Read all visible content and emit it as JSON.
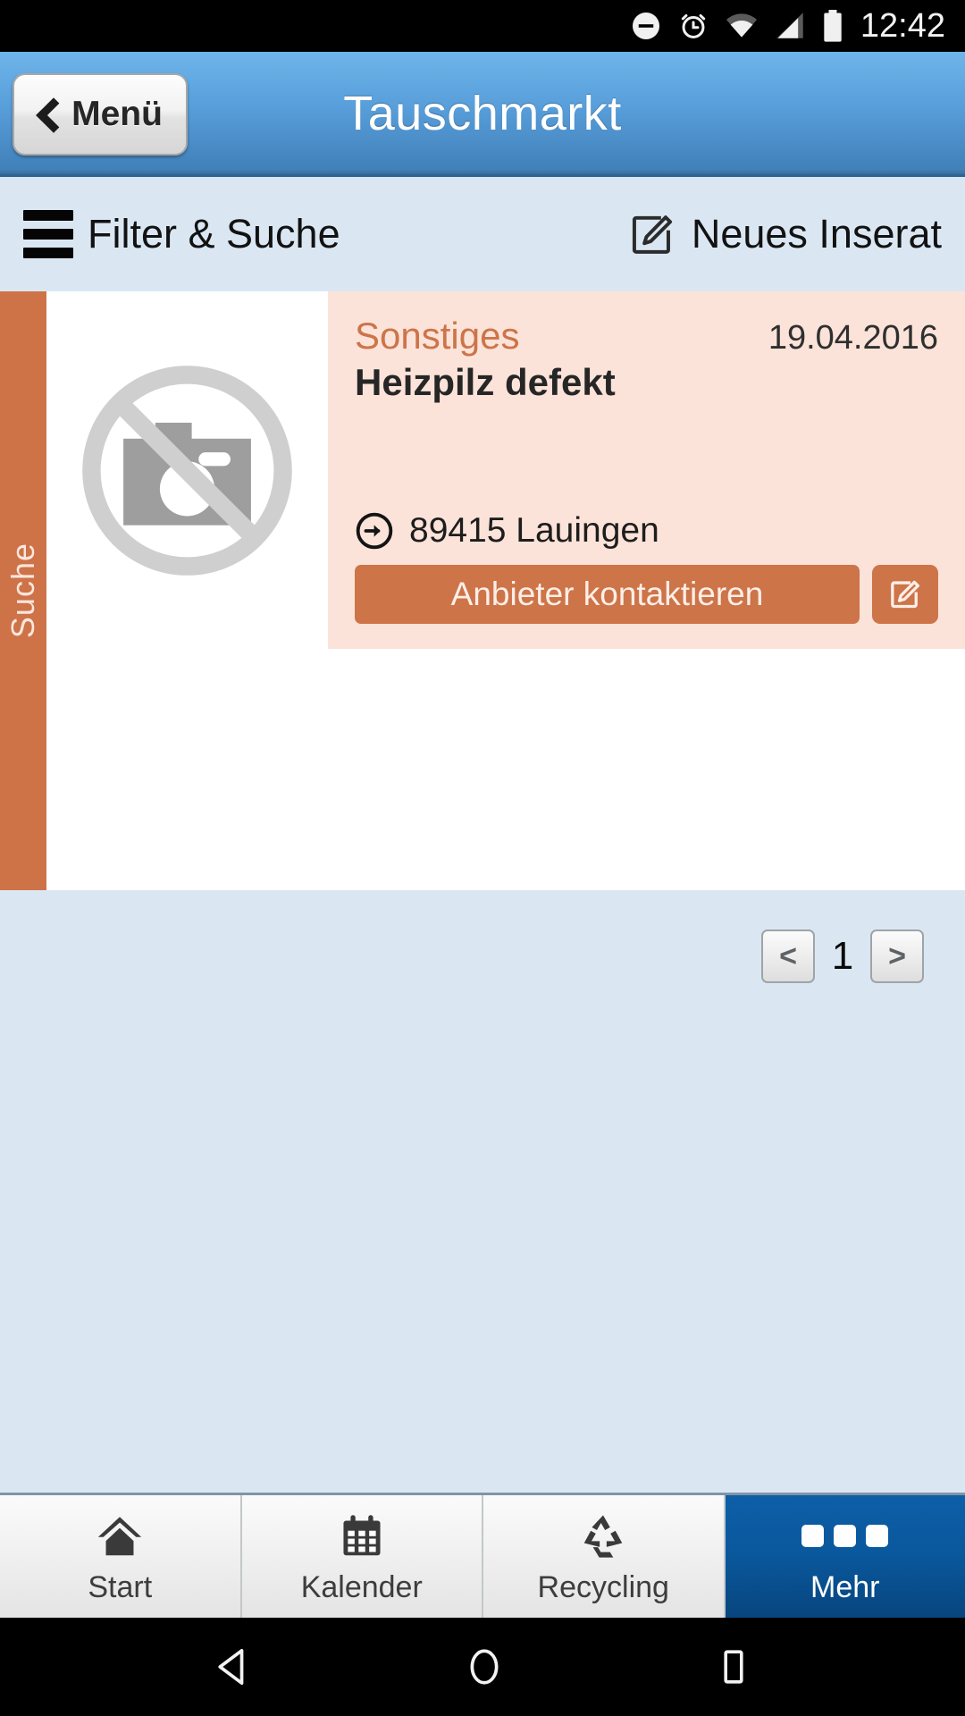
{
  "status_bar": {
    "time": "12:42",
    "icons": [
      "do-not-disturb-icon",
      "alarm-icon",
      "wifi-icon",
      "signal-icon",
      "battery-icon"
    ]
  },
  "header": {
    "title": "Tauschmarkt",
    "menu_label": "Menü",
    "back_icon": "chevron-left-icon",
    "gradient_top": "#6fb5ea",
    "gradient_bottom": "#376f9f"
  },
  "filter_bar": {
    "filter_label": "Filter & Suche",
    "filter_icon": "hamburger-icon",
    "new_listing_label": "Neues Inserat",
    "new_listing_icon": "edit-pencil-icon",
    "background": "#dae7f3"
  },
  "side_tab": {
    "label": "Suche",
    "color": "#ce7248"
  },
  "listings": [
    {
      "category": "Sonstiges",
      "date": "19.04.2016",
      "title": "Heizpilz defekt",
      "location": "89415 Lauingen",
      "location_icon": "arrow-right-circle-icon",
      "thumbnail_icon": "no-photo-placeholder-icon",
      "contact_label": "Anbieter kontaktieren",
      "edit_icon": "edit-pencil-icon",
      "accent": "#cd7449",
      "background": "#fbe3d9"
    }
  ],
  "pagination": {
    "prev_label": "<",
    "next_label": ">",
    "current_page": "1"
  },
  "tab_bar": {
    "items": [
      {
        "label": "Start",
        "icon": "home-icon",
        "active": false
      },
      {
        "label": "Kalender",
        "icon": "calendar-icon",
        "active": false
      },
      {
        "label": "Recycling",
        "icon": "recycling-icon",
        "active": false
      },
      {
        "label": "Mehr",
        "icon": "three-dots-icon",
        "active": true
      }
    ],
    "active_color": "#0a579c"
  },
  "nav_bar": {
    "back_icon": "android-back-icon",
    "home_icon": "android-home-icon",
    "recents_icon": "android-recents-icon"
  }
}
